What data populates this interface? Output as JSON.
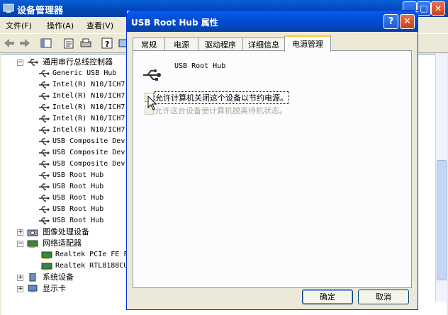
{
  "device_manager": {
    "title": "设备管理器",
    "menu": [
      "文件(F)",
      "操作(A)",
      "查看(V)"
    ],
    "tree": {
      "usb_controllers": {
        "label": "通用串行总线控制器",
        "children": [
          "Generic USB Hub",
          "Intel(R) N10/ICH7",
          "Intel(R) N10/ICH7",
          "Intel(R) N10/ICH7",
          "Intel(R) N10/ICH7",
          "Intel(R) N10/ICH7",
          "USB Composite Dev",
          "USB Composite Dev",
          "USB Composite Dev",
          "USB Root Hub",
          "USB Root Hub",
          "USB Root Hub",
          "USB Root Hub",
          "USB Root Hub"
        ]
      },
      "imaging": "图像处理设备",
      "network": {
        "label": "网络适配器",
        "children": [
          "Realtek PCIe FE F",
          "Realtek RTL8188CU"
        ]
      },
      "system": "系统设备",
      "display": "显示卡"
    }
  },
  "dialog": {
    "title": "USB Root Hub 属性",
    "tabs": [
      "常规",
      "电源",
      "驱动程序",
      "详细信息",
      "电源管理"
    ],
    "active_tab": "电源管理",
    "device_name": "USB Root Hub",
    "option_allow_off": "允许计算机关闭这个设备以节约电源。",
    "option_allow_wake": "允许这台设备使计算机脱离待机状态。",
    "option_allow_off_checked": false,
    "option_allow_wake_enabled": false,
    "ok": "确定",
    "cancel": "取消",
    "help_glyph": "?",
    "close_glyph": "✕"
  },
  "colors": {
    "titlebar": "#0054e3",
    "window_bg": "#ece9d8",
    "disabled_text": "#aca899"
  }
}
